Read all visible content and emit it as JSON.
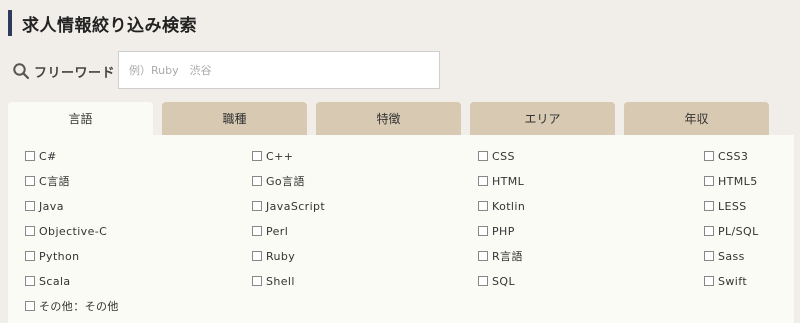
{
  "page_title": "求人情報絞り込み検索",
  "search": {
    "label": "フリーワード",
    "placeholder": "例）Ruby　渋谷",
    "value": ""
  },
  "tabs": [
    {
      "label": "言語",
      "active": true
    },
    {
      "label": "職種",
      "active": false
    },
    {
      "label": "特徴",
      "active": false
    },
    {
      "label": "エリア",
      "active": false
    },
    {
      "label": "年収",
      "active": false
    }
  ],
  "languages": {
    "columns": [
      [
        "C#",
        "C言語",
        "Java",
        "Objective-C",
        "Python",
        "Scala",
        "その他：その他"
      ],
      [
        "C++",
        "Go言語",
        "JavaScript",
        "Perl",
        "Ruby",
        "Shell"
      ],
      [
        "CSS",
        "HTML",
        "Kotlin",
        "PHP",
        "R言語",
        "SQL"
      ],
      [
        "CSS3",
        "HTML5",
        "LESS",
        "PL/SQL",
        "Sass",
        "Swift"
      ]
    ]
  }
}
